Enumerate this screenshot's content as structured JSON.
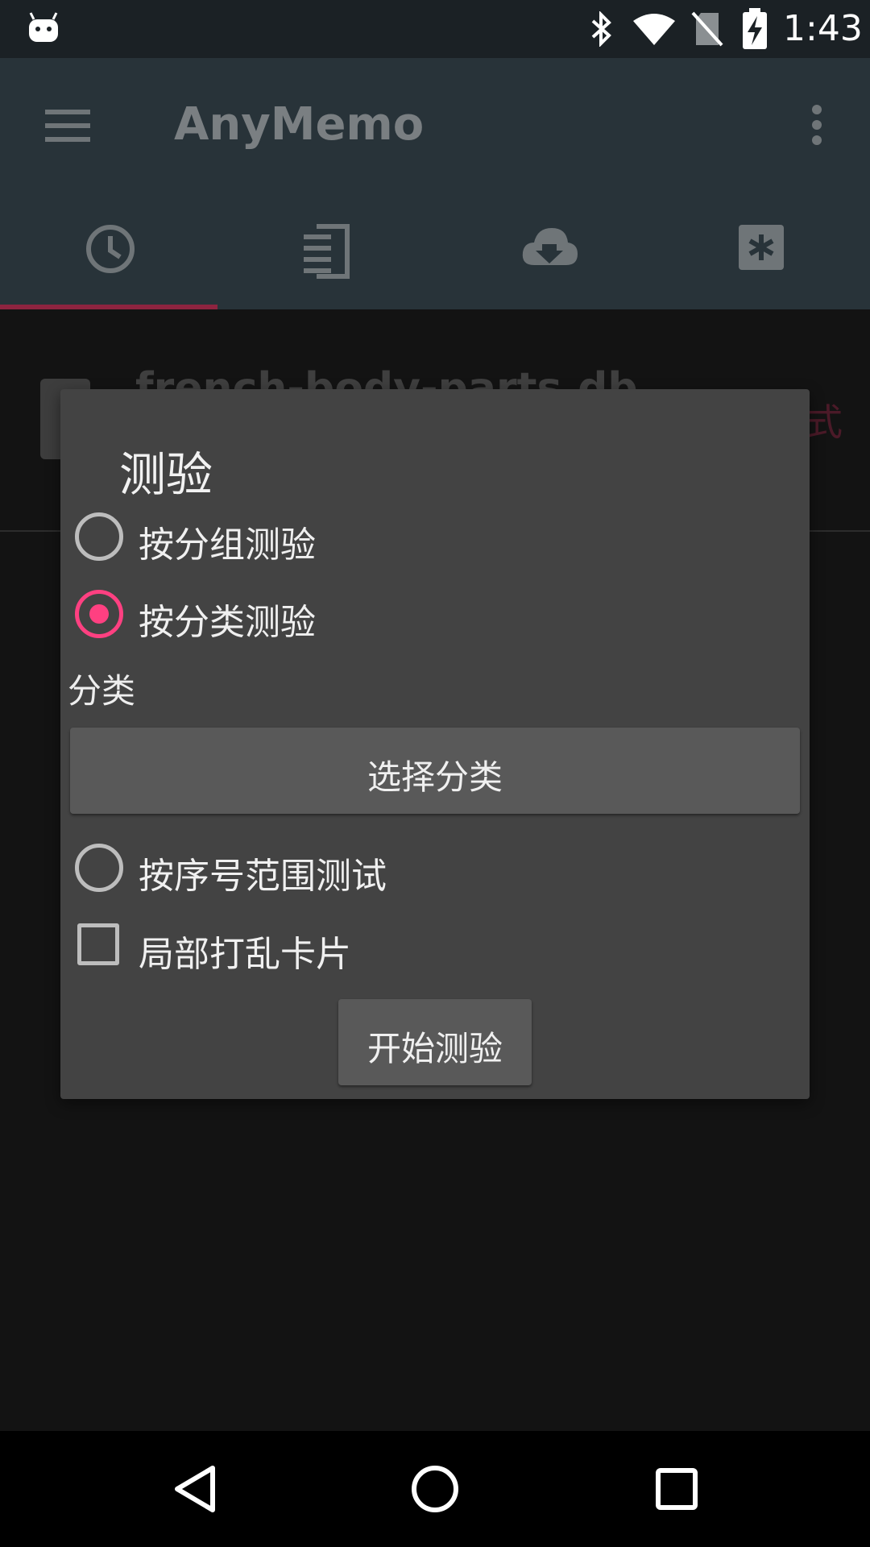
{
  "status_bar": {
    "time": "1:43"
  },
  "app": {
    "title": "AnyMemo"
  },
  "tabs": [
    {
      "icon": "clock-icon"
    },
    {
      "icon": "document-list-icon"
    },
    {
      "icon": "cloud-download-icon"
    },
    {
      "icon": "asterisk-box-icon"
    }
  ],
  "background_list": {
    "item_title": "french-body-parts.db",
    "item_side_text": "式"
  },
  "dialog": {
    "title": "测验",
    "options": [
      {
        "label": "按分组测验",
        "checked": false
      },
      {
        "label": "按分类测验",
        "checked": true
      }
    ],
    "category_label": "分类",
    "select_category_button": "选择分类",
    "range_option": {
      "label": "按序号范围测试",
      "checked": false
    },
    "shuffle_checkbox": {
      "label": "局部打乱卡片",
      "checked": false
    },
    "start_button": "开始测验"
  },
  "colors": {
    "accent": "#ff4081",
    "dialog_bg": "#434343",
    "appbar_bg": "#283339"
  }
}
